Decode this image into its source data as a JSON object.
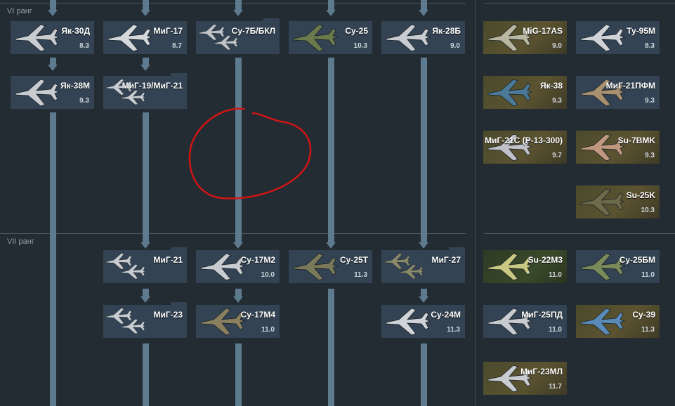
{
  "ranks": [
    {
      "label": "VI ранг"
    },
    {
      "label": "VII ранг"
    }
  ],
  "vehicles": [
    {
      "id": "yak30d",
      "name": "Як-30Д",
      "br": "8.3",
      "premium": false,
      "folder": false,
      "color": "#c8ccd0"
    },
    {
      "id": "mig17",
      "name": "МиГ-17",
      "br": "8.7",
      "premium": false,
      "folder": false,
      "color": "#d4d8dc"
    },
    {
      "id": "su7b",
      "name": "Су-7Б/БКЛ",
      "br": "",
      "premium": false,
      "folder": true,
      "color": "#c0c4c8"
    },
    {
      "id": "su25",
      "name": "Су-25",
      "br": "10.3",
      "premium": false,
      "folder": false,
      "color": "#6b7a4c"
    },
    {
      "id": "yak28b",
      "name": "Як-28Б",
      "br": "9.0",
      "premium": false,
      "folder": false,
      "color": "#c8ccd0"
    },
    {
      "id": "mig17as",
      "name": "MiG-17AS",
      "br": "9.0",
      "premium": true,
      "folder": false,
      "color": "#b8b8a0"
    },
    {
      "id": "tu95m",
      "name": "Ту-95М",
      "br": "8.3",
      "premium": false,
      "folder": false,
      "color": "#d0d4d8"
    },
    {
      "id": "yak38m",
      "name": "Як-38М",
      "br": "9.3",
      "premium": false,
      "folder": false,
      "color": "#c8ccd0"
    },
    {
      "id": "mig19",
      "name": "МиГ-19/МиГ-21",
      "br": "",
      "premium": false,
      "folder": true,
      "color": "#c8ccd0"
    },
    {
      "id": "yak38",
      "name": "Як-38",
      "br": "9.3",
      "premium": true,
      "folder": false,
      "color": "#4a7a98"
    },
    {
      "id": "mig21pfm",
      "name": "МиГ-21ПФМ",
      "br": "9.3",
      "premium": false,
      "folder": false,
      "color": "#a89070"
    },
    {
      "id": "mig21s",
      "name": "МиГ-21С (Р-13-300)",
      "br": "9.7",
      "premium": true,
      "folder": false,
      "color": "#c0c0c8"
    },
    {
      "id": "su7bmk",
      "name": "Su-7BMK",
      "br": "9.3",
      "premium": true,
      "folder": false,
      "color": "#c09880"
    },
    {
      "id": "su25k",
      "name": "Su-25K",
      "br": "10.3",
      "premium": true,
      "folder": false,
      "color": "#6b6a4a"
    },
    {
      "id": "mig21",
      "name": "МиГ-21",
      "br": "",
      "premium": false,
      "folder": true,
      "color": "#c8ccd0"
    },
    {
      "id": "su17m2",
      "name": "Су-17М2",
      "br": "10.0",
      "premium": false,
      "folder": false,
      "color": "#c8ccd0"
    },
    {
      "id": "su25t",
      "name": "Су-25Т",
      "br": "11.3",
      "premium": false,
      "folder": false,
      "color": "#7a7a5a"
    },
    {
      "id": "mig27",
      "name": "МиГ-27",
      "br": "",
      "premium": false,
      "folder": true,
      "color": "#8a8a6a"
    },
    {
      "id": "su22m3",
      "name": "Su-22M3",
      "br": "11.0",
      "premium": true,
      "folder": false,
      "color": "#c8c880",
      "green": true
    },
    {
      "id": "su25bm",
      "name": "Су-25БМ",
      "br": "11.0",
      "premium": false,
      "folder": false,
      "color": "#7a8a5a"
    },
    {
      "id": "mig23",
      "name": "МиГ-23",
      "br": "",
      "premium": false,
      "folder": true,
      "color": "#c8ccd0"
    },
    {
      "id": "su17m4",
      "name": "Су-17М4",
      "br": "11.0",
      "premium": false,
      "folder": false,
      "color": "#8a8060"
    },
    {
      "id": "su24m",
      "name": "Су-24М",
      "br": "11.3",
      "premium": false,
      "folder": false,
      "color": "#d0d4d8"
    },
    {
      "id": "mig25pd",
      "name": "МиГ-25ПД",
      "br": "11.0",
      "premium": false,
      "folder": false,
      "color": "#c8ccd0"
    },
    {
      "id": "su39",
      "name": "Су-39",
      "br": "11.3",
      "premium": true,
      "folder": false,
      "color": "#5a8ab8"
    },
    {
      "id": "mig23ml",
      "name": "МиГ-23МЛ",
      "br": "11.7",
      "premium": true,
      "folder": false,
      "color": "#c8ccd0"
    }
  ],
  "colors": {
    "background": "#232b33",
    "card": "#334353",
    "connector": "#5d7a8f",
    "annotation": "#d01515"
  }
}
